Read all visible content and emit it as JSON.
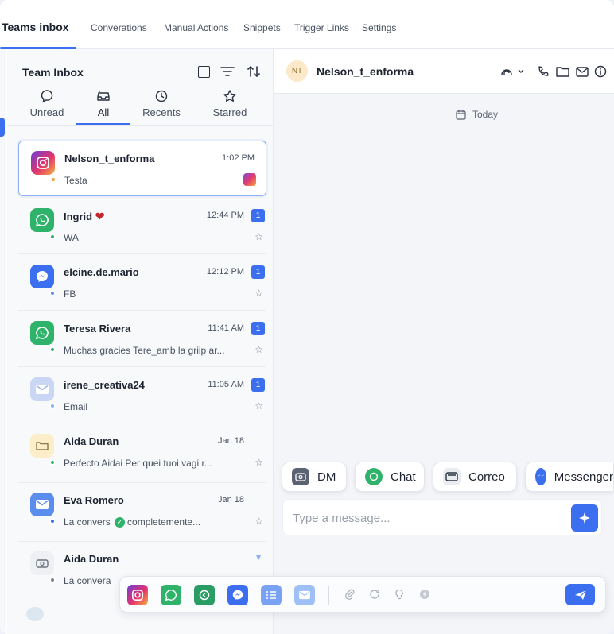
{
  "nav": {
    "brand": "Teams inbox",
    "links": [
      "Converations",
      "Manual Actions",
      "Snippets",
      "Trigger Links",
      "Settings"
    ]
  },
  "inbox": {
    "title": "Team Inbox",
    "tabs": [
      {
        "label": "Unread",
        "icon": "inbox-bubble-icon"
      },
      {
        "label": "All",
        "icon": "tray-icon"
      },
      {
        "label": "Recents",
        "icon": "clock-icon"
      },
      {
        "label": "Starred",
        "icon": "star-icon"
      }
    ],
    "active_tab": "All",
    "conversations": [
      {
        "name": "Nelson_t_enforma",
        "time": "1:02 PM",
        "preview": "Testa",
        "channel": "instagram",
        "selected": true
      },
      {
        "name": "Ingrid",
        "time": "12:44 PM",
        "preview": "WA",
        "channel": "whatsapp",
        "badge": "1",
        "emoji": "heart"
      },
      {
        "name": "elcine.de.mario",
        "time": "12:12 PM",
        "preview": "FB",
        "channel": "messenger",
        "badge": "1"
      },
      {
        "name": "Teresa Rivera",
        "time": "11:41 AM",
        "preview": "Muchas gracies Tere_amb la griip ar...",
        "channel": "whatsapp",
        "badge": "1"
      },
      {
        "name": "irene_creativa24",
        "time": "11:05 AM",
        "preview": "Email",
        "channel": "email",
        "badge": "1"
      },
      {
        "name": "Aida Duran",
        "time": "Jan 18",
        "preview": "Perfecto Aidai Per quei tuoi vagi r...",
        "channel": "chat"
      },
      {
        "name": "Eva Romero",
        "time": "Jan 18",
        "preview_a": "La convers",
        "preview_b": "completemente...",
        "channel": "email"
      },
      {
        "name": "Aida Duran",
        "time": "",
        "preview": "La convera",
        "channel": "chat"
      }
    ]
  },
  "chat": {
    "contact_initials": "NT",
    "contact_name": "Nelson_t_enforma",
    "date_divider": "Today",
    "channel_pills": [
      "DM",
      "Chat",
      "Correo",
      "Messenger"
    ],
    "composer_placeholder": "Type a message..."
  },
  "colors": {
    "accent": "#3b6ff0",
    "whatsapp": "#2fb36b",
    "messenger": "#3b6ff0",
    "email": "#5b8def",
    "unread_badge": "#3b6ff0"
  }
}
